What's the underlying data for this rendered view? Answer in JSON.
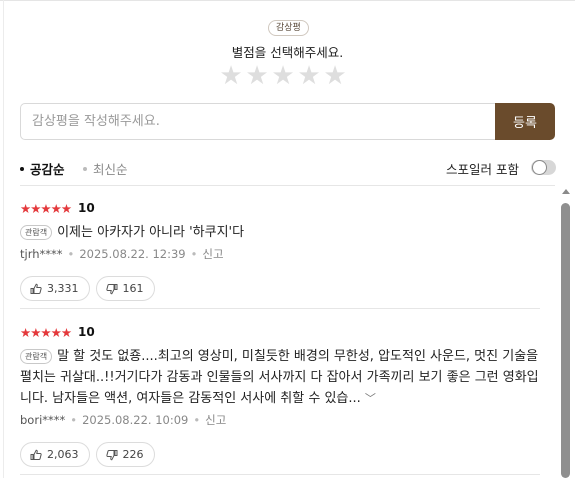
{
  "write": {
    "badge": "감상평",
    "prompt": "별점을 선택해주세요.",
    "stars": [
      "★",
      "★",
      "★",
      "★",
      "★"
    ],
    "input_placeholder": "감상평을 작성해주세요.",
    "submit_label": "등록"
  },
  "sort": {
    "active": "공감순",
    "inactive": "최신순",
    "spoiler_label": "스포일러 포함",
    "spoiler_on": false
  },
  "reviews": [
    {
      "stars": "★★★★★",
      "score": "10",
      "tag": "관람객",
      "text": "이제는 아카자가 아니라 '하쿠지'다",
      "expand": "",
      "user": "tjrh****",
      "date": "2025.08.22. 12:39",
      "report": "신고",
      "likes": "3,331",
      "dislikes": "161"
    },
    {
      "stars": "★★★★★",
      "score": "10",
      "tag": "관람객",
      "text": "말 할 것도 없죵....최고의 영상미, 미칠듯한 배경의 무한성, 압도적인 사운드, 멋진 기술을 펼치는 귀살대..!!거기다가 감동과 인물들의 서사까지 다 잡아서 가족끼리 보기 좋은 그런 영화입니다. 남자들은 액션, 여자들은 감동적인 서사에 취할 수 있습...",
      "expand": "﹀",
      "user": "bori****",
      "date": "2025.08.22. 10:09",
      "report": "신고",
      "likes": "2,063",
      "dislikes": "226"
    }
  ]
}
